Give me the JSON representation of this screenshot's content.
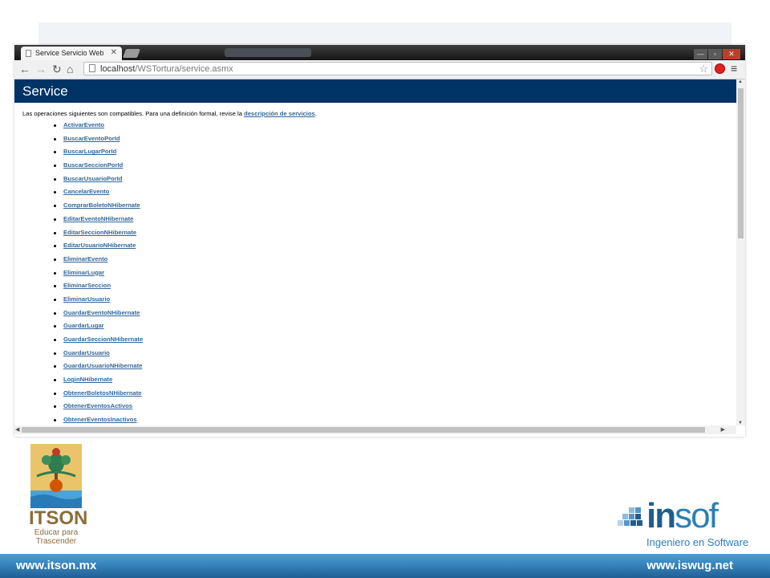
{
  "browser": {
    "tab_title": "Service Servicio Web",
    "tab_close": "✕",
    "window_controls": {
      "minimize": "—",
      "maximize": "▫",
      "close": "✕"
    },
    "nav": {
      "back": "←",
      "forward": "→",
      "reload": "↻",
      "home": "⌂"
    },
    "url_host": "localhost",
    "url_path": "/WSTortura/service.asmx",
    "star": "☆",
    "menu": "≡"
  },
  "page": {
    "title": "Service",
    "intro_text": "Las operaciones siguientes son compatibles. Para una definición formal, revise la ",
    "intro_link": "descripción de servicios",
    "intro_end": ".",
    "operations": [
      "ActivarEvento",
      "BuscarEventoPorId",
      "BuscarLugarPorId",
      "BuscarSeccionPorId",
      "BuscarUsuarioPorId",
      "CancelarEvento",
      "ComprarBoletoNHibernate",
      "EditarEventoNHibernate",
      "EditarSeccionNHibernate",
      "EditarUsuarioNHibernate",
      "EliminarEvento",
      "EliminarLugar",
      "EliminarSeccion",
      "EliminarUsuario",
      "GuardarEventoNHibernate",
      "GuardarLugar",
      "GuardarSeccionNHibernate",
      "GuardarUsuario",
      "GuardarUsuarioNHibernate",
      "LoginNHibernate",
      "ObtenerBoletosNHibernate",
      "ObtenerEventosActivos",
      "ObtenerEventosInactivos"
    ]
  },
  "slide": {
    "itson_word": "ITSON",
    "itson_slogan_1": "Educar para",
    "itson_slogan_2": "Trascender",
    "insof_in": "in",
    "insof_sof": "sof",
    "insof_tagline": "Ingeniero en Software",
    "footer_left": "www.itson.mx",
    "footer_right": "www.iswug.net"
  },
  "colors": {
    "header_bg": "#003366",
    "link": "#336699",
    "footer": "#1f5f96",
    "itson_gold": "#8a6d3b",
    "insof_blue": "#1f5e8c"
  }
}
